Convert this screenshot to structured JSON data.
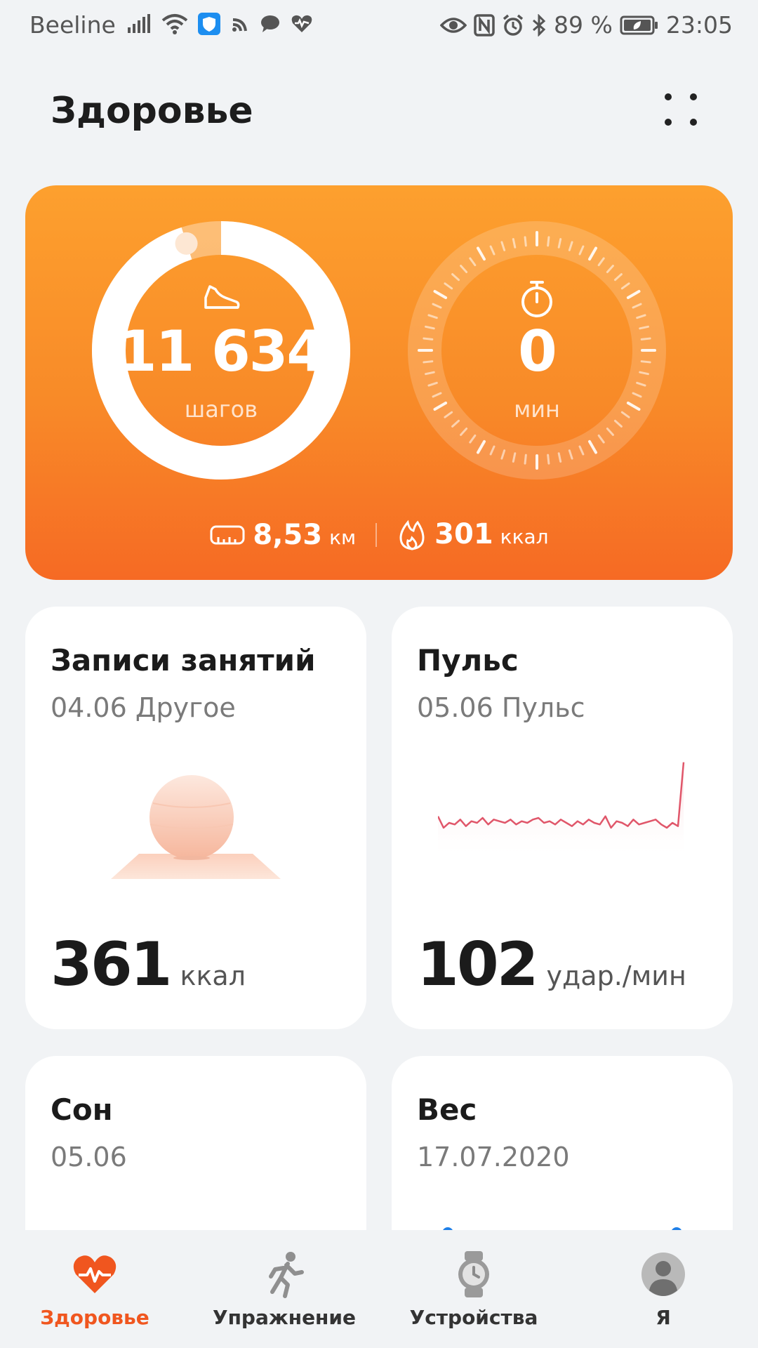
{
  "status_bar": {
    "carrier": "Beeline",
    "battery": "89 %",
    "time": "23:05",
    "icons": [
      "signal-icon",
      "wifi-icon",
      "vpn-shield-icon",
      "cast-icon",
      "chat-icon",
      "heart-pulse-icon",
      "eye-icon",
      "nfc-icon",
      "alarm-icon",
      "bluetooth-icon",
      "battery-icon"
    ]
  },
  "header": {
    "title": "Здоровье",
    "menu_icon": "grid-dots-icon"
  },
  "activity": {
    "steps_value": "11 634",
    "steps_unit": "шагов",
    "steps_progress": 0.95,
    "active_value": "0",
    "active_unit": "мин",
    "distance_value": "8,53",
    "distance_unit": "км",
    "calories_value": "301",
    "calories_unit": "ккал",
    "colors": {
      "gradient_top": "#fda02e",
      "gradient_bottom": "#f66a24"
    }
  },
  "tiles": {
    "workouts": {
      "title": "Записи занятий",
      "subtitle": "04.06 Другое",
      "value": "361",
      "unit": "ккал"
    },
    "pulse": {
      "title": "Пульс",
      "subtitle": "05.06 Пульс",
      "value": "102",
      "unit": "удар./мин",
      "sparkline": [
        62,
        55,
        58,
        57,
        60,
        56,
        59,
        58,
        61,
        57,
        60,
        59,
        58,
        60,
        57,
        59,
        58,
        60,
        61,
        58,
        59,
        57,
        60,
        58,
        56,
        59,
        57,
        60,
        58,
        57,
        62,
        55,
        59,
        58,
        56,
        60,
        57,
        58,
        59,
        60,
        57,
        55,
        58,
        56,
        95
      ]
    },
    "sleep": {
      "title": "Сон",
      "subtitle": "05.06"
    },
    "weight": {
      "title": "Вес",
      "subtitle": "17.07.2020"
    }
  },
  "bottom_nav": [
    {
      "label": "Здоровье",
      "icon": "heart-pulse-icon",
      "active": true
    },
    {
      "label": "Упражнение",
      "icon": "runner-icon",
      "active": false
    },
    {
      "label": "Устройства",
      "icon": "watch-icon",
      "active": false
    },
    {
      "label": "Я",
      "icon": "profile-icon",
      "active": false
    }
  ],
  "accent_color": "#f0561f"
}
